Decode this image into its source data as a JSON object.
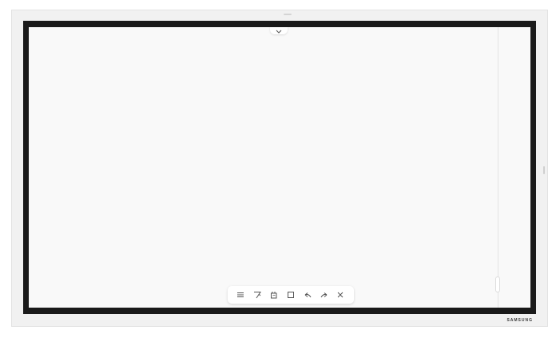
{
  "device": {
    "brand": "SAMSUNG"
  },
  "colors": {
    "bezel": "#f1f1f1",
    "screen_frame": "#1a1a1a",
    "canvas": "#f9f9f9",
    "icon": "#555555"
  },
  "top_handle": {
    "icon": "chevron-down-icon"
  },
  "toolbar": {
    "tools": [
      {
        "name": "menu",
        "icon": "menu-icon"
      },
      {
        "name": "pen",
        "icon": "pen-icon"
      },
      {
        "name": "eraser",
        "icon": "eraser-icon"
      },
      {
        "name": "select",
        "icon": "select-icon"
      },
      {
        "name": "undo",
        "icon": "undo-icon"
      },
      {
        "name": "redo",
        "icon": "redo-icon"
      },
      {
        "name": "close",
        "icon": "close-icon"
      }
    ]
  }
}
